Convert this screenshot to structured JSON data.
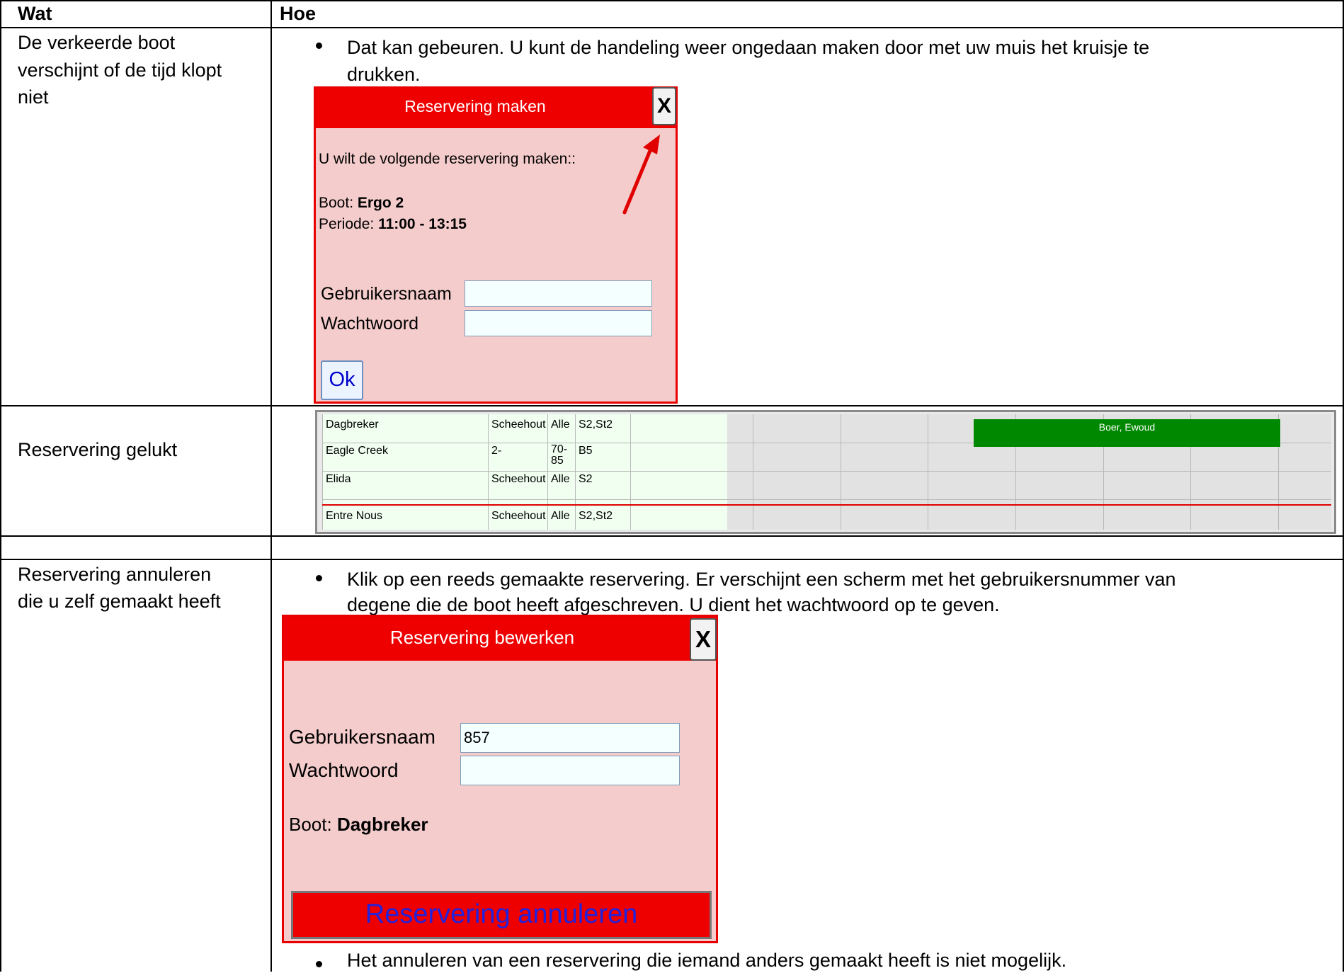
{
  "table": {
    "header": {
      "col1": "Wat",
      "col2": "Hoe"
    },
    "row1": {
      "wat_lines": [
        "De verkeerde boot",
        "verschijnt of de tijd klopt",
        "niet"
      ],
      "hoe_lines": [
        "Dat kan gebeuren. U kunt de handeling weer ongedaan maken door met uw muis het kruisje te",
        "drukken."
      ]
    },
    "row2": {
      "wat": "Reservering gelukt"
    },
    "row4": {
      "wat_lines": [
        "Reservering annuleren",
        "die u zelf gemaakt heeft"
      ],
      "hoe_lines": [
        "Klik op een reeds gemaakte reservering.  Er verschijnt een scherm met het gebruikersnummer van",
        "degene die de boot heeft afgeschreven.  U dient het wachtwoord op te geven."
      ],
      "note": "Het annuleren van een reservering die iemand anders gemaakt heeft is niet mogelijk."
    }
  },
  "dialog_make": {
    "title": "Reservering maken",
    "close": "X",
    "intro": "U wilt de volgende reservering maken::",
    "boot_label": "Boot: ",
    "boot_value": "Ergo 2",
    "periode_label": "Periode: ",
    "periode_value": "11:00 - 13:15",
    "user_label": "Gebruikersnaam",
    "user_value": "",
    "pass_label": "Wachtwoord",
    "pass_value": "",
    "ok": "Ok"
  },
  "planning": {
    "rows": [
      {
        "name": "Dagbreker",
        "type": "Scheehout",
        "weight": "Alle",
        "cert": "S2,St2"
      },
      {
        "name": "Eagle Creek",
        "type": "2-",
        "weight": "70-\n85",
        "cert": "B5"
      },
      {
        "name": "Elida",
        "type": "Scheehout",
        "weight": "Alle",
        "cert": "S2"
      },
      {
        "name": "Entre Nous",
        "type": "Scheehout",
        "weight": "Alle",
        "cert": "S2,St2"
      }
    ],
    "reservation": "Boer, Ewoud",
    "reservation_color": "#008800"
  },
  "dialog_edit": {
    "title": "Reservering bewerken",
    "close": "X",
    "user_label": "Gebruikersnaam",
    "user_value": "857",
    "pass_label": "Wachtwoord",
    "pass_value": "",
    "boot_label": "Boot: ",
    "boot_value": "Dagbreker",
    "cancel_button": "Reservering annuleren"
  },
  "colors": {
    "dialog_red": "#ee0000",
    "dialog_bg": "#f5cccc",
    "arrow": "#e00000"
  }
}
